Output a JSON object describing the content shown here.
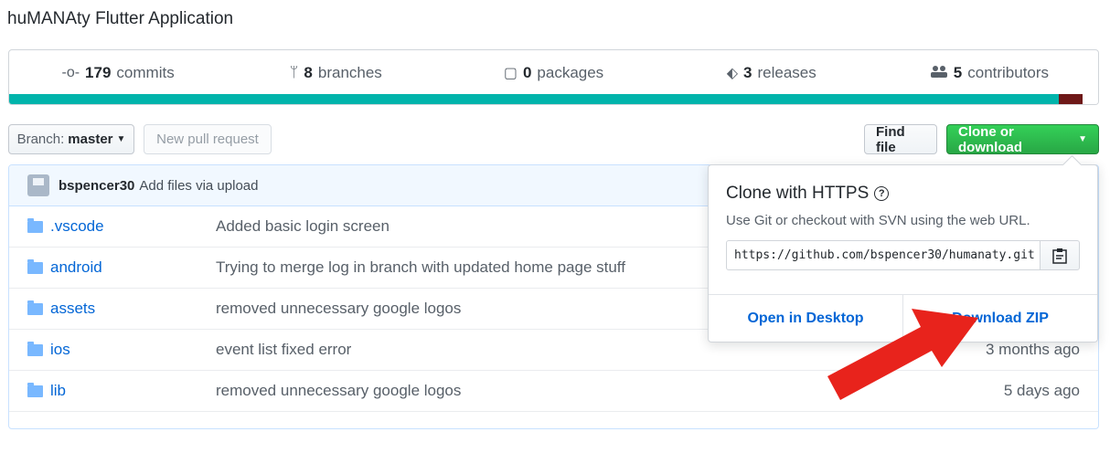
{
  "repo": {
    "description": "huMANAty Flutter Application"
  },
  "summary": [
    {
      "icon": "commits-icon",
      "glyph": "-o-",
      "count": "179",
      "label": "commits"
    },
    {
      "icon": "branch-icon",
      "glyph": "ᛘ",
      "count": "8",
      "label": "branches"
    },
    {
      "icon": "package-icon",
      "glyph": "▢",
      "count": "0",
      "label": "packages"
    },
    {
      "icon": "tag-icon",
      "glyph": "⬖",
      "count": "3",
      "label": "releases"
    },
    {
      "icon": "people-icon",
      "glyph": "👥",
      "count": "5",
      "label": "contributors"
    }
  ],
  "language_colors": {
    "primary": "#00b4ab",
    "secondary": "#6e1818"
  },
  "toolbar": {
    "branch_label": "Branch:",
    "branch_value": "master",
    "new_pr": "New pull request",
    "find_file": "Find file",
    "clone": "Clone or download"
  },
  "latest_commit": {
    "user": "bspencer30",
    "message": "Add files via upload"
  },
  "files": [
    {
      "name": ".vscode",
      "message": "Added basic login screen",
      "age": ""
    },
    {
      "name": "android",
      "message": "Trying to merge log in branch with updated home page stuff",
      "age": ""
    },
    {
      "name": "assets",
      "message": "removed unnecessary google logos",
      "age": ""
    },
    {
      "name": "ios",
      "message": "event list fixed error",
      "age": "3 months ago"
    },
    {
      "name": "lib",
      "message": "removed unnecessary google logos",
      "age": "5 days ago"
    }
  ],
  "clone_popover": {
    "title": "Clone with HTTPS",
    "subtitle": "Use Git or checkout with SVN using the web URL.",
    "url": "https://github.com/bspencer30/humanaty.git",
    "open_desktop": "Open in Desktop",
    "download_zip": "Download ZIP"
  },
  "colors": {
    "accent_green": "#28a745",
    "link_blue": "#0366d6",
    "arrow_red": "#e8231c"
  }
}
